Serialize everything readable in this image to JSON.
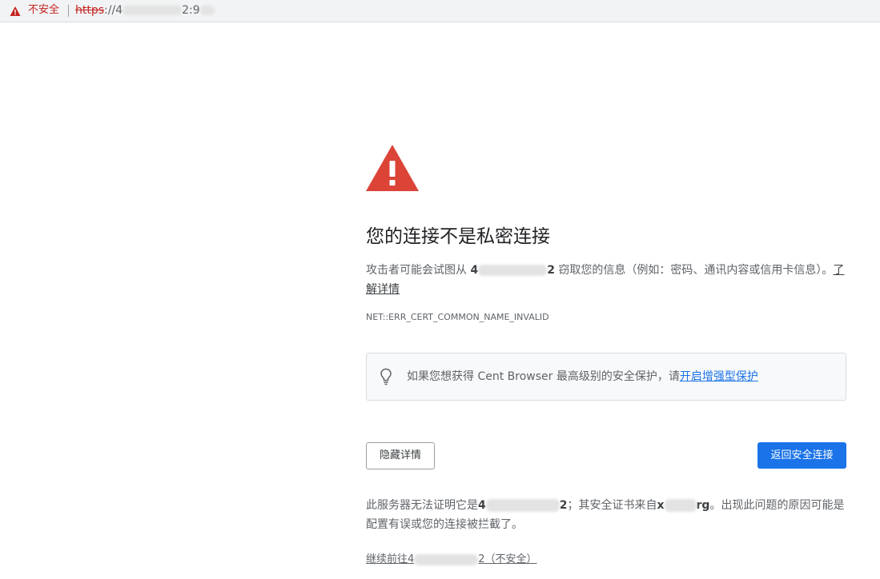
{
  "address_bar": {
    "security_icon": "warning-triangle-icon",
    "security_label": "不安全",
    "url_scheme": "https",
    "url_start": "://4",
    "url_end": "2:9"
  },
  "main": {
    "warning_icon": "warning-triangle-icon",
    "heading": "您的连接不是私密连接",
    "desc_before": "攻击者可能会试图从 ",
    "desc_host_start": "4",
    "desc_host_end": "2",
    "desc_after": " 窃取您的信息（例如：密码、通讯内容或信用卡信息）。",
    "learn_more": "了解详情",
    "error_code": "NET::ERR_CERT_COMMON_NAME_INVALID"
  },
  "enhanced": {
    "icon": "lightbulb-icon",
    "text": "如果您想获得 Cent Browser 最高级别的安全保护，请",
    "link": "开启增强型保护"
  },
  "buttons": {
    "hide_details": "隐藏详情",
    "back_to_safety": "返回安全连接"
  },
  "details": {
    "text1": "此服务器无法证明它是",
    "host_start": "4",
    "host_end": "2",
    "text2": "；其安全证书来自",
    "issuer_start": "x",
    "issuer_end": "rg",
    "text3": "。出现此问题的原因可能是配置有误或您的连接被拦截了。",
    "proceed_start": "继续前往4",
    "proceed_end": "2（不安全）"
  },
  "colors": {
    "warning_red": "#db4437",
    "primary_blue": "#1a73e8"
  }
}
